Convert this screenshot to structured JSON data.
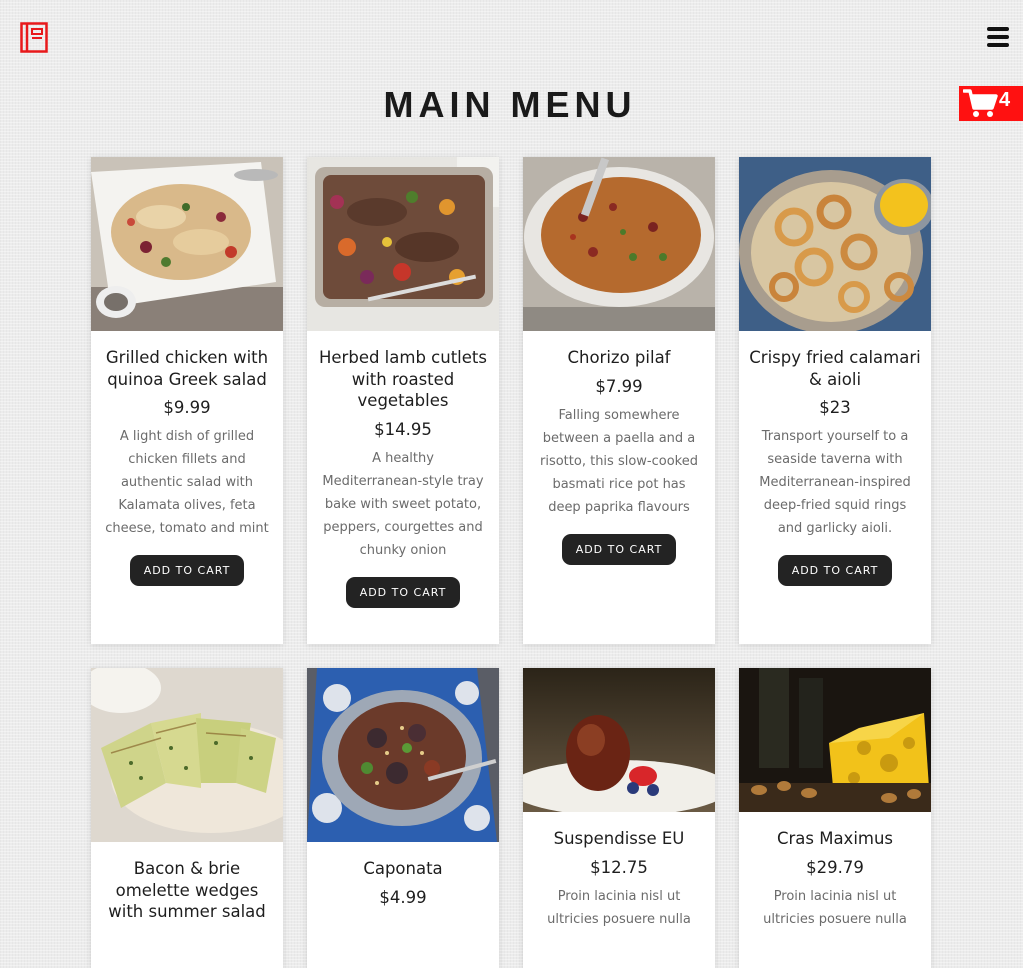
{
  "header": {
    "logo_icon": "menu-book-icon",
    "menu_icon": "hamburger-icon",
    "title": "MAIN MENU",
    "cart": {
      "icon": "shopping-cart-icon",
      "count": "4",
      "color": "#ff1111"
    }
  },
  "add_to_cart_label": "ADD TO CART",
  "items": [
    {
      "name": "Grilled chicken with quinoa Greek salad",
      "price": "$9.99",
      "description": "A light dish of grilled chicken fillets and authentic salad with Kalamata olives, feta cheese, tomato and mint"
    },
    {
      "name": "Herbed lamb cutlets with roasted vegetables",
      "price": "$14.95",
      "description": "A healthy Mediterranean-style tray bake with sweet potato, peppers, courgettes and chunky onion"
    },
    {
      "name": "Chorizo pilaf",
      "price": "$7.99",
      "description": "Falling somewhere between a paella and a risotto, this slow-cooked basmati rice pot has deep paprika flavours"
    },
    {
      "name": "Crispy fried calamari & aioli",
      "price": "$23",
      "description": "Transport yourself to a seaside taverna with Mediterranean-inspired deep-fried squid rings and garlicky aioli."
    },
    {
      "name": "Bacon & brie omelette wedges with summer salad",
      "price": "",
      "description": ""
    },
    {
      "name": "Caponata",
      "price": "$4.99",
      "description": ""
    },
    {
      "name": "Suspendisse EU",
      "price": "$12.75",
      "description": "Proin lacinia nisl ut ultricies posuere nulla"
    },
    {
      "name": "Cras Maximus",
      "price": "$29.79",
      "description": "Proin lacinia nisl ut ultricies posuere nulla"
    }
  ]
}
